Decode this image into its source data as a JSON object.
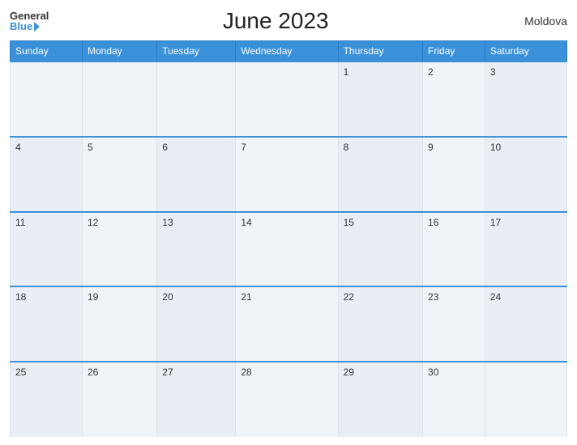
{
  "header": {
    "logo_general": "General",
    "logo_blue": "Blue",
    "title": "June 2023",
    "country": "Moldova"
  },
  "weekdays": [
    "Sunday",
    "Monday",
    "Tuesday",
    "Wednesday",
    "Thursday",
    "Friday",
    "Saturday"
  ],
  "weeks": [
    [
      {
        "day": "",
        "empty": true
      },
      {
        "day": "",
        "empty": true
      },
      {
        "day": "",
        "empty": true
      },
      {
        "day": "",
        "empty": true
      },
      {
        "day": "1",
        "empty": false
      },
      {
        "day": "2",
        "empty": false
      },
      {
        "day": "3",
        "empty": false
      }
    ],
    [
      {
        "day": "4",
        "empty": false
      },
      {
        "day": "5",
        "empty": false
      },
      {
        "day": "6",
        "empty": false
      },
      {
        "day": "7",
        "empty": false
      },
      {
        "day": "8",
        "empty": false
      },
      {
        "day": "9",
        "empty": false
      },
      {
        "day": "10",
        "empty": false
      }
    ],
    [
      {
        "day": "11",
        "empty": false
      },
      {
        "day": "12",
        "empty": false
      },
      {
        "day": "13",
        "empty": false
      },
      {
        "day": "14",
        "empty": false
      },
      {
        "day": "15",
        "empty": false
      },
      {
        "day": "16",
        "empty": false
      },
      {
        "day": "17",
        "empty": false
      }
    ],
    [
      {
        "day": "18",
        "empty": false
      },
      {
        "day": "19",
        "empty": false
      },
      {
        "day": "20",
        "empty": false
      },
      {
        "day": "21",
        "empty": false
      },
      {
        "day": "22",
        "empty": false
      },
      {
        "day": "23",
        "empty": false
      },
      {
        "day": "24",
        "empty": false
      }
    ],
    [
      {
        "day": "25",
        "empty": false
      },
      {
        "day": "26",
        "empty": false
      },
      {
        "day": "27",
        "empty": false
      },
      {
        "day": "28",
        "empty": false
      },
      {
        "day": "29",
        "empty": false
      },
      {
        "day": "30",
        "empty": false
      },
      {
        "day": "",
        "empty": true
      }
    ]
  ]
}
